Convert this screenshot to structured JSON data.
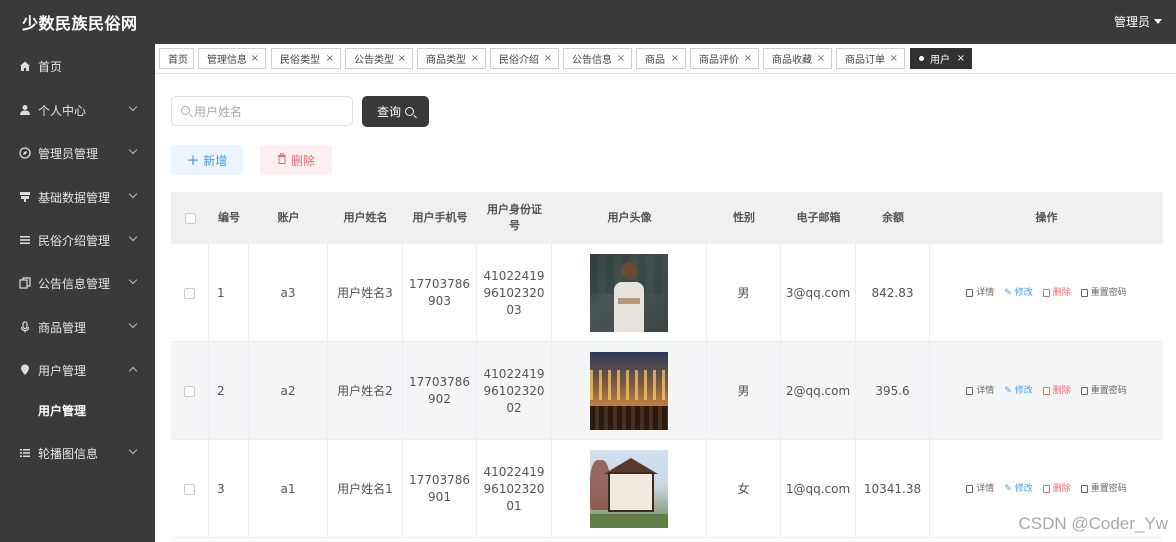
{
  "header": {
    "title": "少数民族民俗网",
    "user": "管理员"
  },
  "sidebar": {
    "items": [
      {
        "label": "首页",
        "icon": "home-icon",
        "expandable": false
      },
      {
        "label": "个人中心",
        "icon": "user-icon",
        "expandable": true
      },
      {
        "label": "管理员管理",
        "icon": "compass-icon",
        "expandable": true
      },
      {
        "label": "基础数据管理",
        "icon": "data-icon",
        "expandable": true
      },
      {
        "label": "民俗介绍管理",
        "icon": "list-icon",
        "expandable": true
      },
      {
        "label": "公告信息管理",
        "icon": "copy-icon",
        "expandable": true
      },
      {
        "label": "商品管理",
        "icon": "mic-icon",
        "expandable": true
      },
      {
        "label": "用户管理",
        "icon": "location-icon",
        "expandable": true,
        "expanded": true
      },
      {
        "label": "轮播图信息",
        "icon": "menu-icon",
        "expandable": true
      }
    ],
    "submenu": {
      "label": "用户管理"
    }
  },
  "tabs": [
    {
      "label": "首页",
      "closable": false
    },
    {
      "label": "管理信息",
      "closable": true
    },
    {
      "label": "民俗类型",
      "closable": true
    },
    {
      "label": "公告类型",
      "closable": true
    },
    {
      "label": "商品类型",
      "closable": true
    },
    {
      "label": "民俗介绍",
      "closable": true
    },
    {
      "label": "公告信息",
      "closable": true
    },
    {
      "label": "商品",
      "closable": true
    },
    {
      "label": "商品评价",
      "closable": true
    },
    {
      "label": "商品收藏",
      "closable": true
    },
    {
      "label": "商品订单",
      "closable": true
    },
    {
      "label": "用户",
      "closable": true,
      "active": true
    }
  ],
  "tab_close": "×",
  "search": {
    "placeholder": "用户姓名",
    "button": "查询"
  },
  "actions": {
    "add": "新增",
    "delete": "删除",
    "add_symbol": "+",
    "delete_symbol": "🗑"
  },
  "table": {
    "headers": [
      "编号",
      "账户",
      "用户姓名",
      "用户手机号",
      "用户身份证号",
      "用户头像",
      "性别",
      "电子邮箱",
      "余额",
      "操作"
    ],
    "rows": [
      {
        "id": "1",
        "account": "a3",
        "name": "用户姓名3",
        "phone": "17703786903",
        "idcard": "410224199610232003",
        "avatar": "student-photo",
        "gender": "男",
        "email": "3@qq.com",
        "balance": "842.83"
      },
      {
        "id": "2",
        "account": "a2",
        "name": "用户姓名2",
        "phone": "17703786902",
        "idcard": "410224199610232002",
        "avatar": "night-street-photo",
        "gender": "男",
        "email": "2@qq.com",
        "balance": "395.6"
      },
      {
        "id": "3",
        "account": "a1",
        "name": "用户姓名1",
        "phone": "17703786901",
        "idcard": "410224199610232001",
        "avatar": "house-photo",
        "gender": "女",
        "email": "1@qq.com",
        "balance": "10341.38"
      }
    ],
    "ops": {
      "detail": "详情",
      "edit": "修改",
      "delete": "删除",
      "reset": "重置密码"
    }
  },
  "watermark": "CSDN @Coder_Yw",
  "colors": {
    "sidebar": "#3a3a3a",
    "primary": "#409eff",
    "danger": "#f56c6c",
    "dark_button": "#393939"
  }
}
